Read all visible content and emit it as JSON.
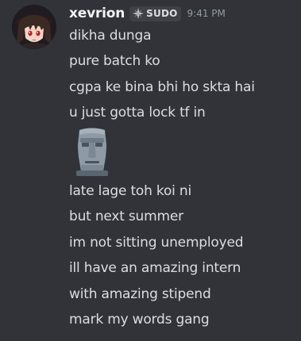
{
  "header": {
    "username": "xevrion",
    "tag_label": "SUDO",
    "tag_icon": "sparkle-icon",
    "timestamp": "9:41 PM"
  },
  "lines_before_emoji": [
    "dikha dunga",
    "pure batch ko",
    "cgpa ke bina bhi ho skta hai",
    "u just gotta lock tf in"
  ],
  "emoji": "moai-emoji",
  "lines_after_emoji": [
    "late lage toh koi ni",
    "but next summer",
    "im not sitting unemployed",
    "ill have an amazing intern",
    "with amazing stipend",
    "mark my words gang"
  ],
  "colors": {
    "background": "#313338",
    "username": "#f2f3f5",
    "text": "#dbdee1",
    "timestamp": "#949ba4",
    "tag_background": "#3f4147"
  }
}
